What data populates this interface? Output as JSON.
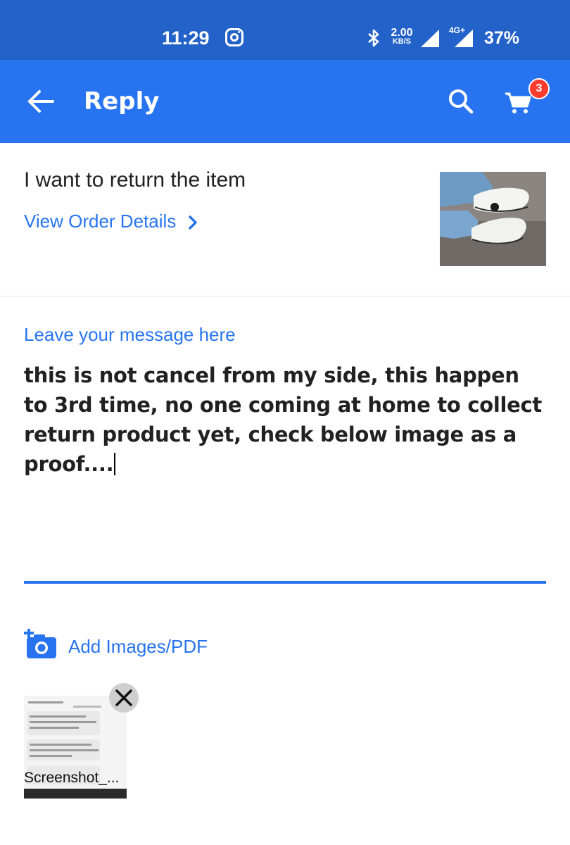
{
  "status_bar": {
    "time": "11:29",
    "network_speed_value": "2.00",
    "network_speed_unit": "KB/S",
    "network_type": "4G+",
    "battery": "37%",
    "icons": [
      "instagram-icon",
      "bluetooth-icon",
      "signal-icon",
      "signal-icon"
    ]
  },
  "app_bar": {
    "title": "Reply",
    "cart_count": "3",
    "colors": {
      "background": "#2874f0",
      "badge": "#ff3b30"
    }
  },
  "order": {
    "title": "I want to return the item",
    "link_label": "View Order Details"
  },
  "message": {
    "label": "Leave your message here",
    "text": "this is not cancel from my side, this happen to 3rd time, no one coming at home to collect return product yet, check below image as a proof...."
  },
  "attachments": {
    "add_label": "Add Images/PDF",
    "items": [
      {
        "name": "Screenshot_..."
      }
    ]
  }
}
